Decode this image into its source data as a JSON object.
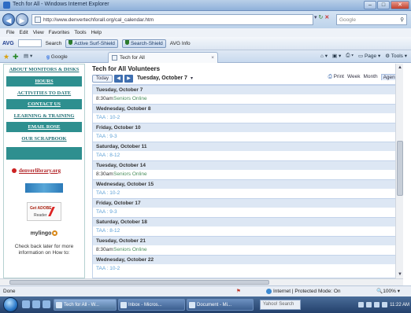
{
  "window": {
    "title": "Tech for All - Windows Internet Explorer",
    "minimize": "–",
    "maximize": "□",
    "close": "✕"
  },
  "address": {
    "url": "http://www.denvertechforall.org/cal_calendar.htm",
    "search_placeholder": "Google"
  },
  "menu": [
    "File",
    "Edit",
    "View",
    "Favorites",
    "Tools",
    "Help"
  ],
  "toolbar": {
    "avg": "AVG",
    "search": "Search",
    "active_surf_shield": "Active Surf-Shield",
    "search_shield": "Search-Shield",
    "avg_info": "AVG Info"
  },
  "tabs": {
    "google": "Google",
    "active": "Tech for All"
  },
  "commandbar": {
    "page": "Page",
    "tools": "Tools"
  },
  "sidebar": {
    "about": "ABOUT MONITORS & DISKS",
    "items": [
      "HOURS",
      "ACTIVITIES TO DATE",
      "CONTACT US",
      "LEARNING & TRAINING",
      "EMAIL ROSE",
      "OUR SCRAPBOOK"
    ],
    "denver_library": "denverlibrary.org",
    "reader_line1": "Get ADOBE",
    "reader_line2": "Reader",
    "lingo": "mylingo",
    "check_back": "Check back later for more information on How to:"
  },
  "calendar": {
    "title": "Tech for All Volunteers",
    "today_label": "Today",
    "prev": "◀",
    "next": "▶",
    "range": "Tuesday, October 7",
    "views": {
      "print": "Print",
      "week": "Week",
      "month": "Month",
      "agenda": "Agenda"
    },
    "days": [
      {
        "header": "Tuesday, October 7",
        "events": [
          {
            "time": "8:30am",
            "title": "Seniors Online"
          }
        ]
      },
      {
        "header": "Wednesday, October 8",
        "events": [
          {
            "time": "",
            "title": "TAA : 10-2"
          }
        ]
      },
      {
        "header": "Friday, October 10",
        "events": [
          {
            "time": "",
            "title": "TAA : 9-3"
          }
        ]
      },
      {
        "header": "Saturday, October 11",
        "events": [
          {
            "time": "",
            "title": "TAA : 8-12"
          }
        ]
      },
      {
        "header": "Tuesday, October 14",
        "events": [
          {
            "time": "8:30am",
            "title": "Seniors Online"
          }
        ]
      },
      {
        "header": "Wednesday, October 15",
        "events": [
          {
            "time": "",
            "title": "TAA : 10-2"
          }
        ]
      },
      {
        "header": "Friday, October 17",
        "events": [
          {
            "time": "",
            "title": "TAA : 9-3"
          }
        ]
      },
      {
        "header": "Saturday, October 18",
        "events": [
          {
            "time": "",
            "title": "TAA : 8-12"
          }
        ]
      },
      {
        "header": "Tuesday, October 21",
        "events": [
          {
            "time": "8:30am",
            "title": "Seniors Online"
          }
        ]
      },
      {
        "header": "Wednesday, October 22",
        "events": [
          {
            "time": "",
            "title": "TAA : 10-2"
          }
        ]
      }
    ]
  },
  "status": {
    "left": "Done",
    "zone": "Internet | Protected Mode: On",
    "zoom": "100%"
  },
  "taskbar": {
    "tasks": [
      "Tech for All - W...",
      "Inbox - Micros...",
      "Document - Mi..."
    ],
    "search_placeholder": "Yahoo! Search",
    "clock": "11:22 AM"
  }
}
